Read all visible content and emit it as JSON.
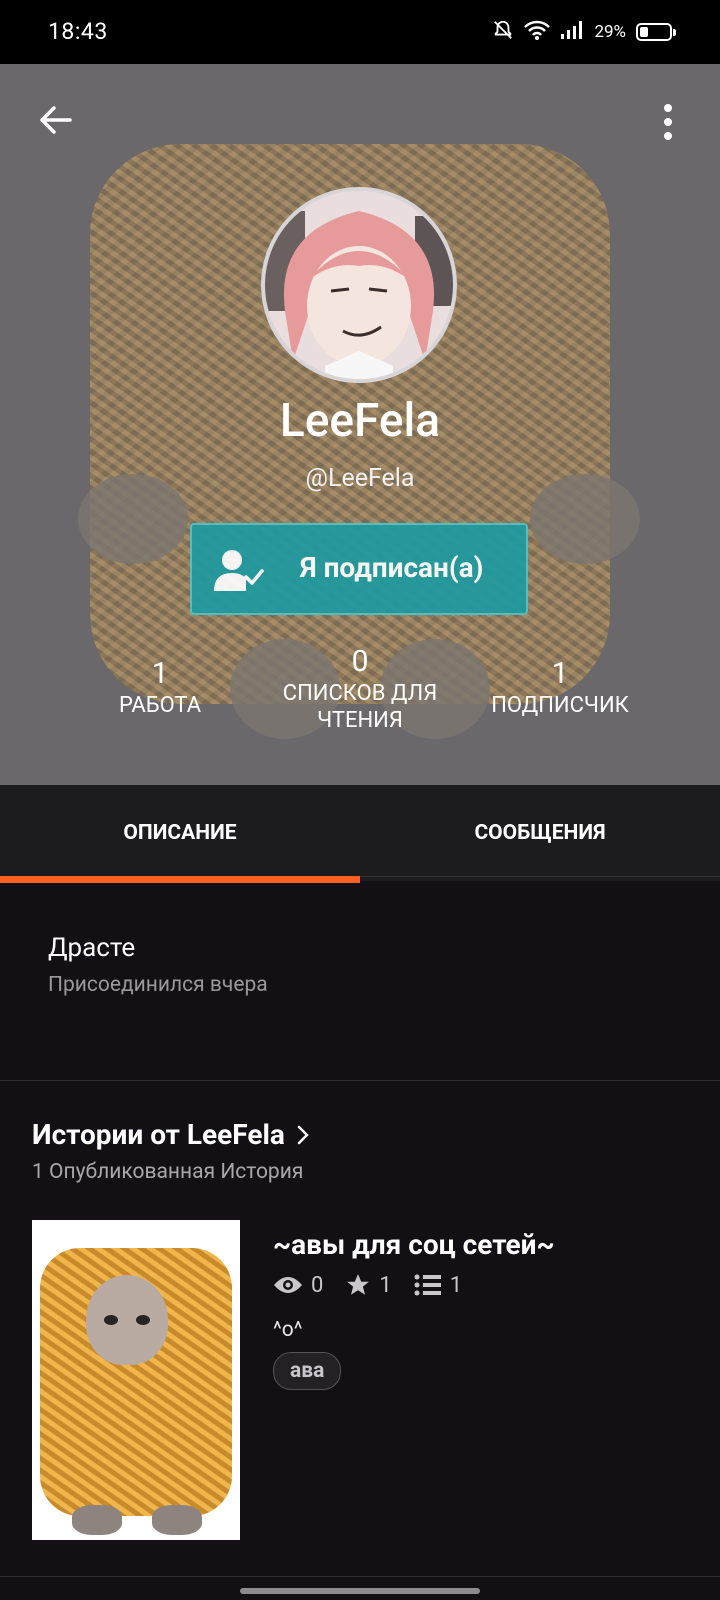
{
  "status_bar": {
    "time": "18:43",
    "battery": "29%",
    "battery_level": 0.29
  },
  "profile": {
    "display_name": "LeeFela",
    "handle": "@LeeFela",
    "follow_button_label": "Я подписан(а)",
    "stats": [
      {
        "value": "1",
        "label": "РАБОТА"
      },
      {
        "value": "0",
        "label": "СПИСКОВ ДЛЯ ЧТЕНИЯ"
      },
      {
        "value": "1",
        "label": "ПОДПИСЧИК"
      }
    ]
  },
  "tabs": [
    {
      "label": "ОПИСАНИЕ",
      "active": true
    },
    {
      "label": "СООБЩЕНИЯ",
      "active": false
    }
  ],
  "about": {
    "text": "Драсте",
    "joined": "Присоединился вчера"
  },
  "stories": {
    "title": "Истории от LeeFela",
    "subtitle": "1 Опубликованная История",
    "items": [
      {
        "title": "~авы для соц сетей~",
        "views": "0",
        "votes": "1",
        "parts": "1",
        "description": "^o^",
        "tag": "ава"
      }
    ]
  },
  "colors": {
    "accent": "#ff6122",
    "follow": "#1e9aa0",
    "background": "#121014"
  }
}
